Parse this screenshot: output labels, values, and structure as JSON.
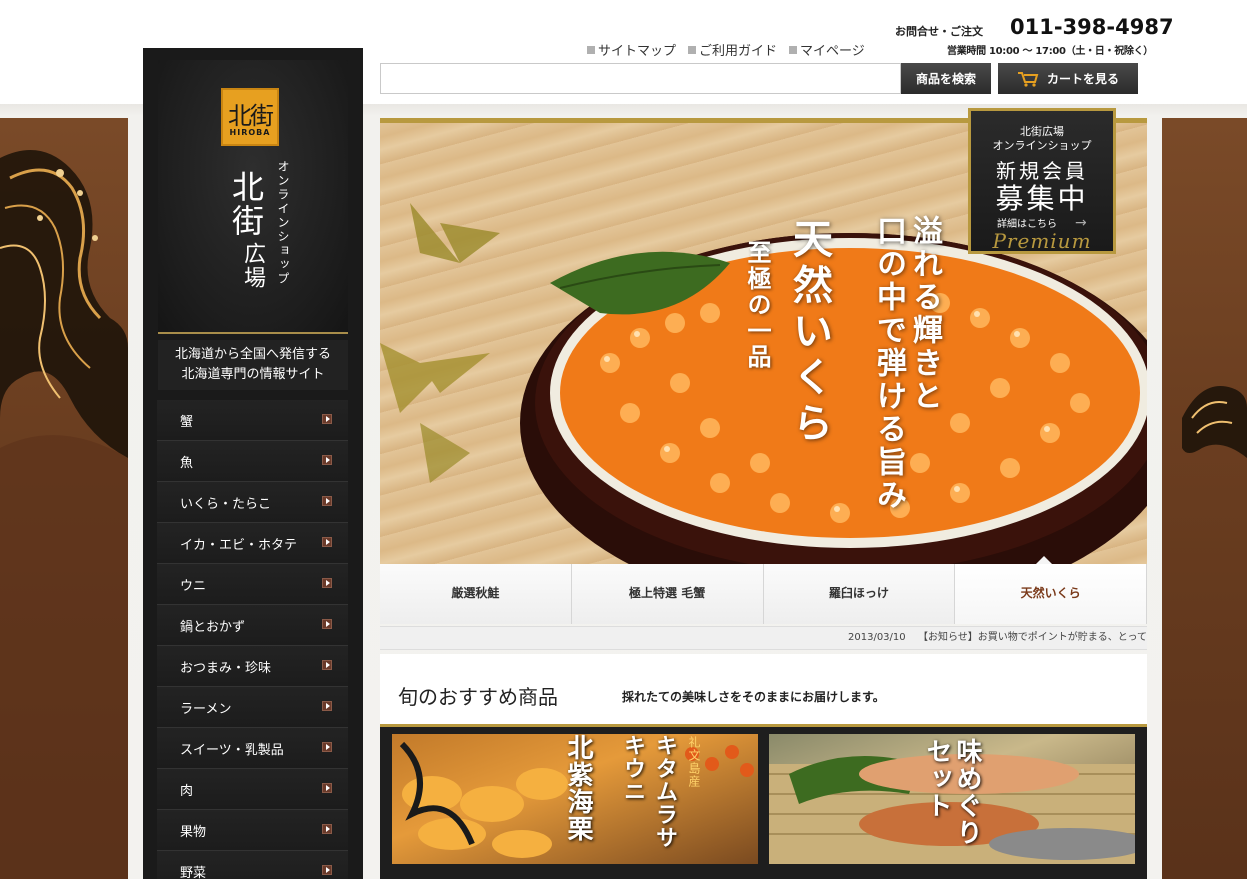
{
  "header": {
    "contact_label": "お問合せ・ご注文",
    "phone": "011-398-4987",
    "hours": "営業時間 10:00 〜 17:00（土・日・祝除く）",
    "links": [
      "サイトマップ",
      "ご利用ガイド",
      "マイページ"
    ],
    "search_placeholder": "",
    "search_button": "商品を検索",
    "cart_button": "カートを見る"
  },
  "sidebar": {
    "logo_kanji": "北街",
    "logo_latin": "HIROBA",
    "shop_name_line1": "北街",
    "shop_name_line2": "広場",
    "shop_sub": "オンラインショップ",
    "tagline_line1": "北海道から全国へ発信する",
    "tagline_line2": "北海道専門の情報サイト",
    "nav": [
      "蟹",
      "魚",
      "いくら・たらこ",
      "イカ・エビ・ホタテ",
      "ウニ",
      "鍋とおかず",
      "おつまみ・珍味",
      "ラーメン",
      "スイーツ・乳製品",
      "肉",
      "果物",
      "野菜"
    ]
  },
  "hero": {
    "copy_small": "至極の一品",
    "copy_large": "天然いくら",
    "copy_right_1": "溢れる輝きと",
    "copy_right_2": "口の中で弾ける旨み"
  },
  "member_badge": {
    "line1": "北街広場",
    "line2": "オンラインショップ",
    "line3": "新規会員",
    "line4": "募集中",
    "details": "詳細はこちら",
    "premium": "Premium"
  },
  "tabs": [
    {
      "label": "厳選秋鮭"
    },
    {
      "label": "極上特選 毛蟹"
    },
    {
      "label": "羅臼ほっけ"
    },
    {
      "label": "天然いくら"
    }
  ],
  "ticker": {
    "date": "2013/03/10",
    "message": "【お知らせ】お買い物でポイントが貯まる、とって"
  },
  "recommend": {
    "title": "旬のおすすめ商品",
    "subtitle": "採れたての美味しさをそのままにお届けします。",
    "product1_line1": "礼文島産",
    "product1_line2": "キタムラサキウニ",
    "product1_line3": "北紫海栗",
    "product2_line1": "味めぐり",
    "product2_line2": "セット"
  },
  "colors": {
    "gold": "#b8993f",
    "sidebar_dark": "#1a1a1a",
    "accent_brown": "#7a3a1a"
  }
}
